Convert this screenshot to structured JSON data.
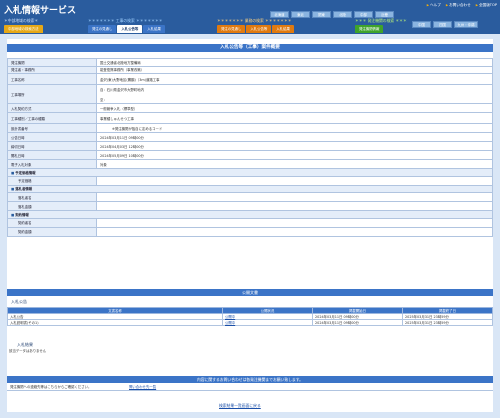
{
  "header": {
    "logo": "入札情報サービス",
    "help_links": [
      "ヘルプ",
      "お問い合わせ",
      "全国版TOP"
    ],
    "regions_row1": [
      "北海道",
      "東北",
      "関東",
      "北陸",
      "中部",
      "近畿"
    ],
    "regions_row2": [
      "中国",
      "四国",
      "九州・沖縄"
    ]
  },
  "categories": [
    {
      "title": "＊中部地域の検索＊",
      "title_color": "#c8dcf8",
      "tabs": [
        {
          "label": "中部地域の検索方法",
          "active": false
        }
      ],
      "tab_color": "#e6a817"
    },
    {
      "title": "＊＊＊＊＊＊＊ 工事の検索 ＊＊＊＊＊＊＊",
      "title_color": "#9fd0ff",
      "tabs": [
        {
          "label": "発注の見通し",
          "active": false
        },
        {
          "label": "入札公告等",
          "active": true
        },
        {
          "label": "入札結果",
          "active": false
        }
      ],
      "tab_color": "#3b74c7"
    },
    {
      "title": "＊＊＊＊＊＊＊ 業務の検索 ＊＊＊＊＊＊＊",
      "title_color": "#ffd27f",
      "tabs": [
        {
          "label": "発注の見通し",
          "active": false
        },
        {
          "label": "入札公告等",
          "active": false
        },
        {
          "label": "入札結果",
          "active": false
        }
      ],
      "tab_color": "#e07a10"
    },
    {
      "title": "＊＊＊ 発注機関の検索 ＊＊＊",
      "title_color": "#b7f07a",
      "tabs": [
        {
          "label": "発注機関情報",
          "active": false
        }
      ],
      "tab_color": "#3fa32a"
    }
  ],
  "page": {
    "section_title": "入札公告等（工事）案件概要",
    "rows": [
      {
        "label": "発注機関",
        "value": "国土交通省北陸地方整備局"
      },
      {
        "label": "発注者・事務所",
        "value": "能登復興事務所（事業改築）"
      },
      {
        "label": "工事名称",
        "value": "金沢(東)大野地区(鷹鵬)（3m)道路工事"
      },
      {
        "label": "工事場所",
        "value": "自：石川県金沢市大野町地内",
        "value2": "至："
      },
      {
        "label": "入札契約方式",
        "value": "一般競争入札（標準型）"
      },
      {
        "label": "工事種別／工事の種類",
        "value": "事業種しゅんせつ工事"
      },
      {
        "label": "設計書番号",
        "value": "",
        "note": "※発注機関が独自に定めるコード"
      },
      {
        "label": "公告日時",
        "value": "2024年03月11日 09時00分"
      },
      {
        "label": "締切日時",
        "value": "2024年04月03日 12時00分"
      },
      {
        "label": "開札日時",
        "value": "2024年05月09日 10時00分"
      },
      {
        "label": "電子入札対象",
        "value": "対象"
      },
      {
        "group": "予定価格情報"
      },
      {
        "label": "予定価格",
        "value": "",
        "sub": true
      },
      {
        "group": "落札者情報"
      },
      {
        "label": "落札者名",
        "value": "",
        "sub": true
      },
      {
        "label": "落札金額",
        "value": "",
        "sub": true
      },
      {
        "group": "契約情報"
      },
      {
        "label": "契約者名",
        "value": "",
        "sub": true
      },
      {
        "label": "契約金額",
        "value": "",
        "sub": true
      }
    ],
    "public_docs_title": "公開文書",
    "bid_notice_heading": "入札公告",
    "docs_columns": [
      "文書名称",
      "公開状況",
      "掲載開始日",
      "掲載終了日"
    ],
    "docs_rows": [
      [
        "入札公告",
        "公開中",
        "2024年03月11日 09時00分",
        "2025年03月31日 23時59分"
      ],
      [
        "入札説明書(その1)",
        "公開中",
        "2024年03月11日 09時00分",
        "2025年03月31日 23時59分"
      ]
    ],
    "bid_result_heading": "入札結果",
    "bid_result_empty": "該当データはありません",
    "notice": "内容に関するお問い合わせは各発注機関までお願い致します。",
    "contact_text": "発注機関への連絡先等はこちらからご確認ください。",
    "contact_link": "問い合わせ先一覧",
    "back_link": "検索結果一覧画面に戻る"
  }
}
